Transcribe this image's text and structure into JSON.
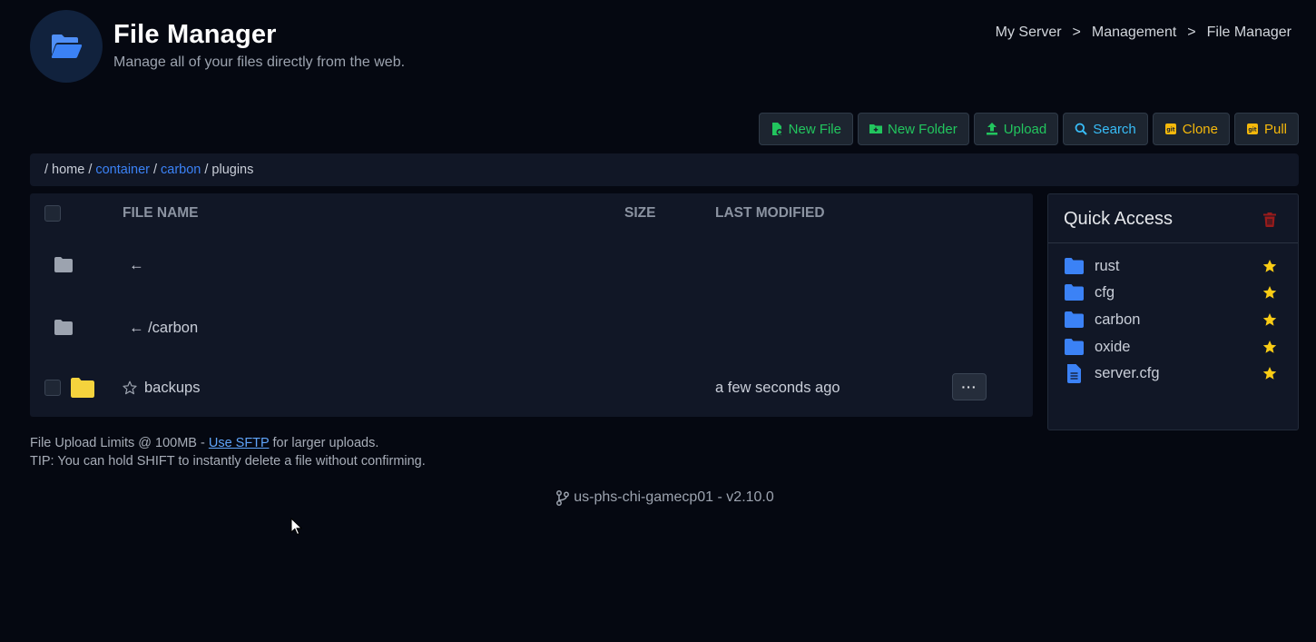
{
  "header": {
    "title": "File Manager",
    "subtitle": "Manage all of your files directly from the web.",
    "icon": "folder-open-icon"
  },
  "breadcrumb": {
    "items": [
      "My Server",
      "Management",
      "File Manager"
    ],
    "separator": ">"
  },
  "toolbar": {
    "new_file": "New File",
    "new_folder": "New Folder",
    "upload": "Upload",
    "search": "Search",
    "clone": "Clone",
    "pull": "Pull"
  },
  "path": {
    "root": "/",
    "home": "home",
    "container": "container",
    "carbon": "carbon",
    "plugins": "plugins",
    "sep": "/"
  },
  "table": {
    "headers": {
      "name": "FILE NAME",
      "size": "SIZE",
      "modified": "LAST MODIFIED"
    },
    "rows": [
      {
        "name": "←",
        "type": "parent"
      },
      {
        "name": "← /carbon",
        "type": "parent"
      },
      {
        "name": "backups",
        "type": "folder",
        "modified": "a few seconds ago",
        "more": "···"
      }
    ]
  },
  "quick_access": {
    "title": "Quick Access",
    "items": [
      {
        "label": "rust",
        "icon": "folder-icon"
      },
      {
        "label": "cfg",
        "icon": "folder-icon"
      },
      {
        "label": "carbon",
        "icon": "folder-icon"
      },
      {
        "label": "oxide",
        "icon": "folder-icon"
      },
      {
        "label": "server.cfg",
        "icon": "file-icon"
      }
    ]
  },
  "notes": {
    "upload_prefix": "File Upload Limits @ 100MB - ",
    "sftp_link": "Use SFTP",
    "upload_suffix": " for larger uploads.",
    "tip": "TIP: You can hold SHIFT to instantly delete a file without confirming."
  },
  "footer": {
    "node": "us-phs-chi-gamecp01 - v2.10.0"
  },
  "colors": {
    "background": "#050811",
    "panel": "#111726",
    "accent_blue": "#3b82f6",
    "green": "#22c55e",
    "amber": "#f5b80b",
    "danger": "#991b1b"
  }
}
